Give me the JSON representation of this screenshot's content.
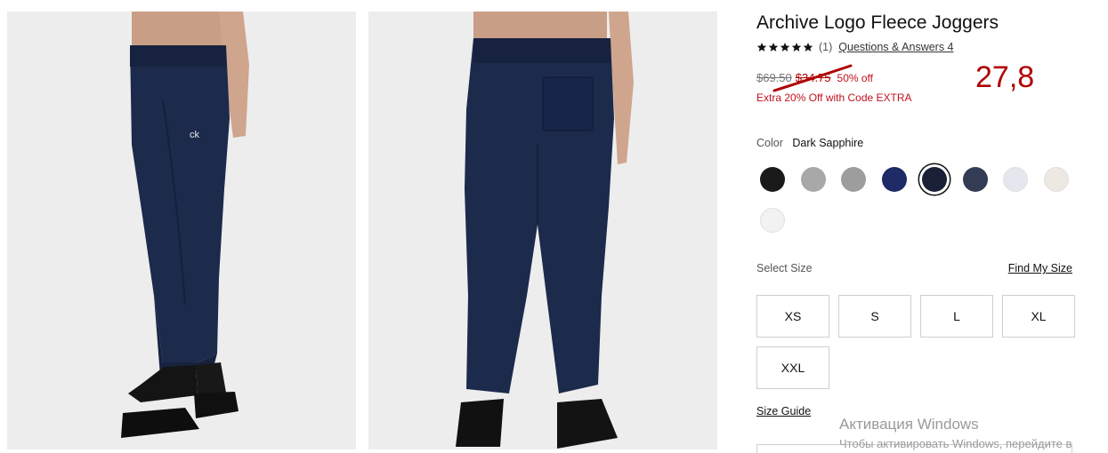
{
  "product": {
    "title": "Archive Logo Fleece Joggers",
    "rating": {
      "stars": 5,
      "review_count": "(1)",
      "qa_link": "Questions & Answers 4"
    },
    "price": {
      "original": "$69.50",
      "sale": "$34.75",
      "discount": "50% off",
      "promo": "Extra 20% Off with Code EXTRA"
    },
    "handwritten_price": "27,8",
    "color": {
      "label": "Color",
      "selected": "Dark Sapphire",
      "swatches": [
        {
          "name": "black",
          "hex": "#1a1a1a"
        },
        {
          "name": "light-gray-heather",
          "hex": "#a8a8a8"
        },
        {
          "name": "gray",
          "hex": "#9d9d9d"
        },
        {
          "name": "navy",
          "hex": "#1e2b66"
        },
        {
          "name": "dark-sapphire",
          "hex": "#1a2035",
          "selected": true
        },
        {
          "name": "slate-navy",
          "hex": "#333b55"
        },
        {
          "name": "light-blue",
          "hex": "#e4e8ee"
        },
        {
          "name": "cream",
          "hex": "#ece9e3"
        },
        {
          "name": "white",
          "hex": "#f2f2f2"
        }
      ]
    },
    "sizes": {
      "label": "Select Size",
      "find_size": "Find My Size",
      "options": [
        "XS",
        "S",
        "L",
        "XL",
        "XXL"
      ]
    },
    "size_guide": "Size Guide"
  },
  "system": {
    "watermark_title": "Активация Windows",
    "watermark_sub": "Чтобы активировать Windows, перейдите в"
  },
  "colors": {
    "accent_red": "#c1121f",
    "pants": "#1c2a4b"
  }
}
